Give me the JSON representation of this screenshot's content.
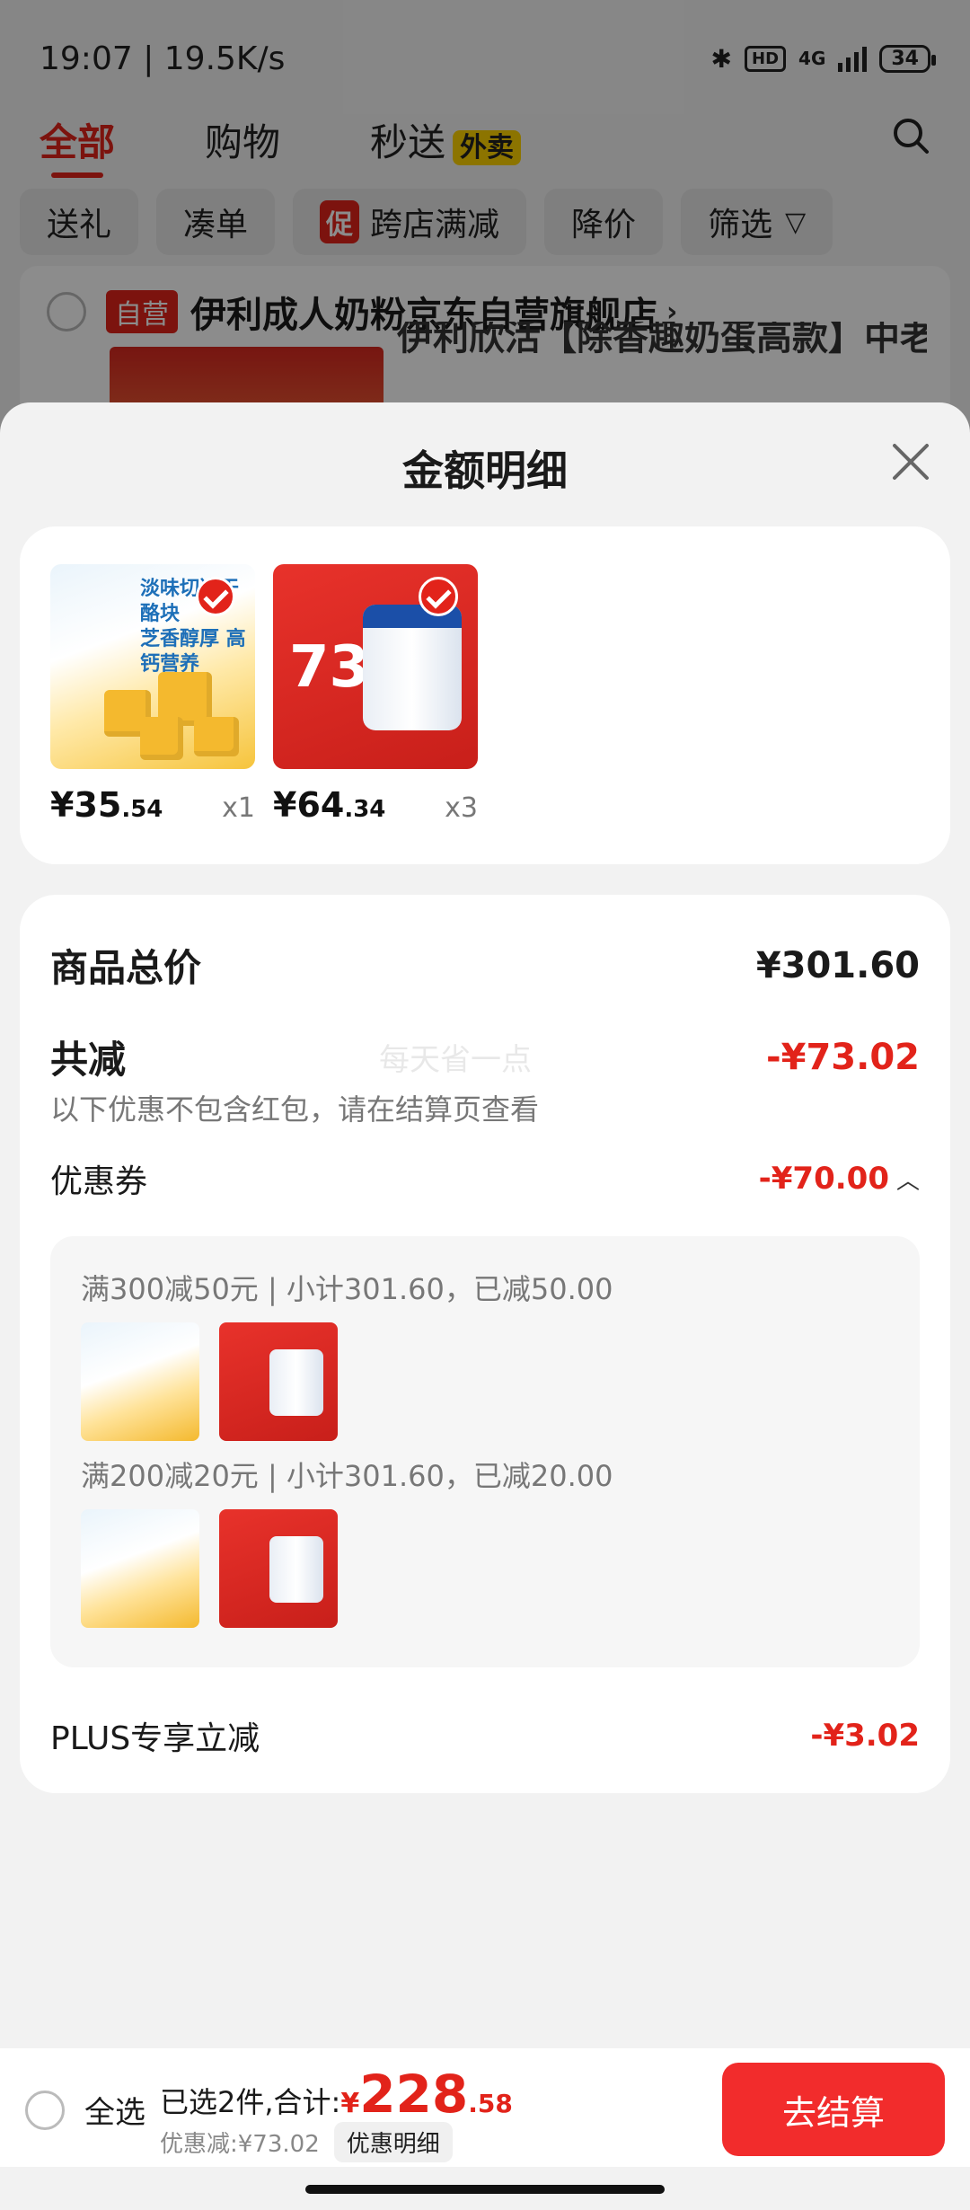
{
  "status_bar": {
    "time": "19:07 | 19.5K/s",
    "hd": "HD",
    "net": "4G",
    "battery": "34"
  },
  "top_tabs": [
    "全部",
    "购物",
    "秒送"
  ],
  "waimai_badge": "外卖",
  "filters": {
    "gift": "送礼",
    "bundle": "凑单",
    "promo_tag": "促",
    "cross_store": "跨店满减",
    "price_drop": "降价",
    "filter": "筛选"
  },
  "shop": {
    "badge": "自营",
    "name": "伊利成人奶粉京东自营旗舰店",
    "product_title_partial": "伊利欣活【除香趣奶蛋高款】中老"
  },
  "sheet": {
    "title": "金额明细",
    "items": [
      {
        "thumb_text": "淡味切达干酪块\n芝香醇厚 高钙营养",
        "price_int": "¥35",
        "price_dec": ".54",
        "qty": "x1"
      },
      {
        "thumb_text": "73",
        "price_int": "¥64",
        "price_dec": ".34",
        "qty": "x3"
      }
    ],
    "total_label": "商品总价",
    "total_value": "¥301.60",
    "discount_label": "共减",
    "discount_value": "-¥73.02",
    "discount_note": "以下优惠不包含红包，请在结算页查看",
    "watermark": "每天省一点",
    "coupon_label": "优惠券",
    "coupon_value": "-¥70.00",
    "coupon_lines": [
      "满300减50元 | 小计301.60，已减50.00",
      "满200减20元 | 小计301.60，已减20.00"
    ],
    "plus_label": "PLUS专享立减",
    "plus_value": "-¥3.02"
  },
  "checkout": {
    "select_all": "全选",
    "selected_prefix": "已选2件,合计:",
    "currency": "¥",
    "total_int": "228",
    "total_dec": ".58",
    "discount_text": "优惠减:¥73.02",
    "detail_btn": "优惠明细",
    "pay_btn": "去结算"
  },
  "colors": {
    "accent_red": "#e2231a",
    "pay_red": "#f22c2c",
    "waimai_yellow": "#ffd400"
  }
}
